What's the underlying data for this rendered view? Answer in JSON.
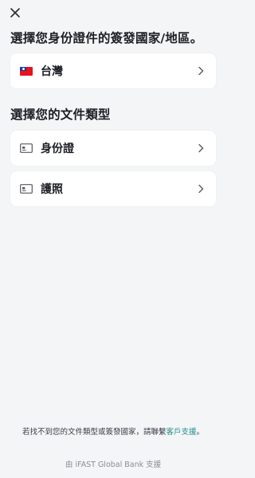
{
  "header": {
    "close_icon": "close-icon"
  },
  "country_section": {
    "title": "選擇您身份證件的簽發國家/地區。",
    "selected_country": {
      "label": "台灣",
      "icon": "taiwan-flag-icon"
    }
  },
  "document_section": {
    "title": "選擇您的文件類型",
    "items": [
      {
        "label": "身份證",
        "icon": "id-card-icon"
      },
      {
        "label": "護照",
        "icon": "id-card-icon"
      }
    ]
  },
  "footer": {
    "help_text": "若找不到您的文件類型或簽發國家，請聯繫",
    "help_link": "客戶支援",
    "help_suffix": "。",
    "powered_by": "由 iFAST Global Bank 支援"
  },
  "colors": {
    "link": "#1e8f8a",
    "background": "#f4f5f7"
  }
}
